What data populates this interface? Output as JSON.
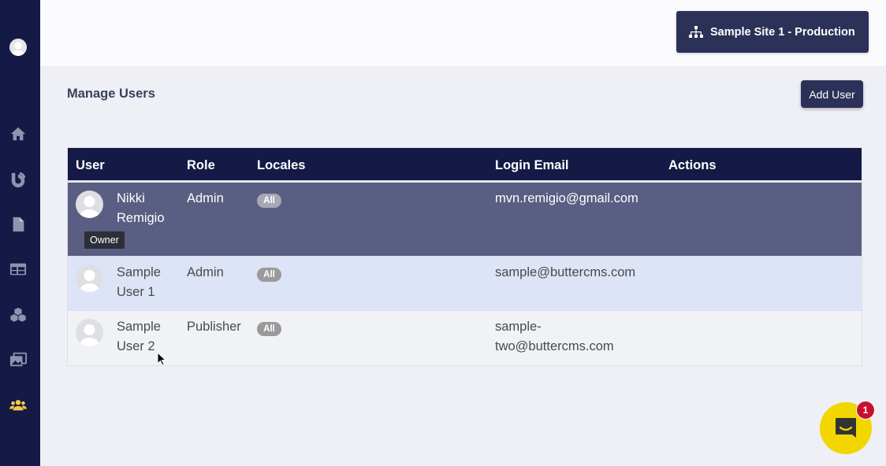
{
  "site": {
    "name": "Sample Site 1 - Production"
  },
  "page": {
    "title": "Manage Users",
    "add_user_label": "Add User"
  },
  "sidebar": {
    "items": [
      {
        "icon": "home-icon"
      },
      {
        "icon": "blog-icon"
      },
      {
        "icon": "page-icon"
      },
      {
        "icon": "collections-table-icon"
      },
      {
        "icon": "components-cubes-icon"
      },
      {
        "icon": "media-icon"
      },
      {
        "icon": "users-icon",
        "active": true
      }
    ],
    "active_color": "#f2c94c"
  },
  "table": {
    "columns": [
      "User",
      "Role",
      "Locales",
      "Login Email",
      "Actions"
    ],
    "rows": [
      {
        "name": "Nikki Remigio",
        "tag": "Owner",
        "role": "Admin",
        "locale": "All",
        "email": "mvn.remigio@gmail.com"
      },
      {
        "name": "Sample User 1",
        "role": "Admin",
        "locale": "All",
        "email": "sample@buttercms.com"
      },
      {
        "name": "Sample User 2",
        "role": "Publisher",
        "locale": "All",
        "email": "sample-two@buttercms.com"
      }
    ]
  },
  "chat": {
    "badge_count": "1"
  },
  "colors": {
    "sidebar": "#141a45",
    "primary_button": "#2c3157",
    "selected_row": "#5a5e82",
    "hover_row": "#dde4f7",
    "chat": "#f2d600"
  }
}
